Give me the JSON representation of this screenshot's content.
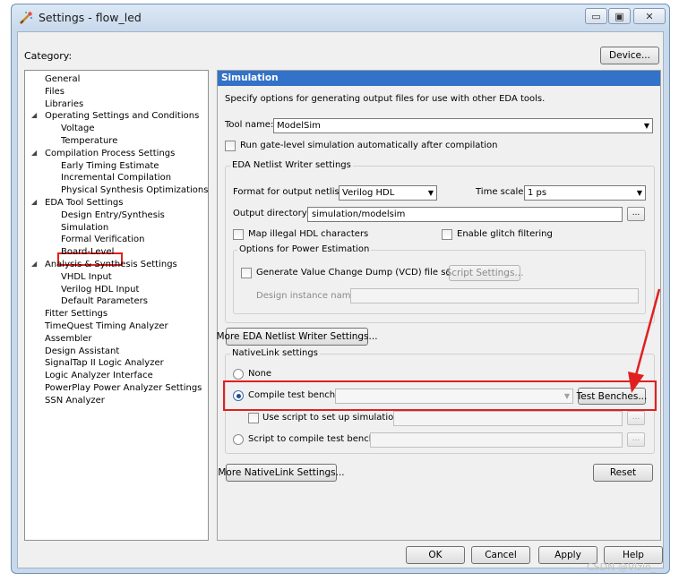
{
  "window": {
    "title": "Settings - flow_led",
    "minimize_glyph": "▭",
    "maximize_glyph": "▣",
    "close_glyph": "✕"
  },
  "category": {
    "label": "Category:"
  },
  "device_button": "Device...",
  "tree": [
    {
      "label": "General",
      "level": 0
    },
    {
      "label": "Files",
      "level": 0
    },
    {
      "label": "Libraries",
      "level": 0
    },
    {
      "label": "Operating Settings and Conditions",
      "level": 0,
      "expanded": true
    },
    {
      "label": "Voltage",
      "level": 1
    },
    {
      "label": "Temperature",
      "level": 1
    },
    {
      "label": "Compilation Process Settings",
      "level": 0,
      "expanded": true
    },
    {
      "label": "Early Timing Estimate",
      "level": 1
    },
    {
      "label": "Incremental Compilation",
      "level": 1
    },
    {
      "label": "Physical Synthesis Optimizations",
      "level": 1
    },
    {
      "label": "EDA Tool Settings",
      "level": 0,
      "expanded": true
    },
    {
      "label": "Design Entry/Synthesis",
      "level": 1
    },
    {
      "label": "Simulation",
      "level": 1,
      "selected": true
    },
    {
      "label": "Formal Verification",
      "level": 1
    },
    {
      "label": "Board-Level",
      "level": 1
    },
    {
      "label": "Analysis & Synthesis Settings",
      "level": 0,
      "expanded": true
    },
    {
      "label": "VHDL Input",
      "level": 1
    },
    {
      "label": "Verilog HDL Input",
      "level": 1
    },
    {
      "label": "Default Parameters",
      "level": 1
    },
    {
      "label": "Fitter Settings",
      "level": 0
    },
    {
      "label": "TimeQuest Timing Analyzer",
      "level": 0
    },
    {
      "label": "Assembler",
      "level": 0
    },
    {
      "label": "Design Assistant",
      "level": 0
    },
    {
      "label": "SignalTap II Logic Analyzer",
      "level": 0
    },
    {
      "label": "Logic Analyzer Interface",
      "level": 0
    },
    {
      "label": "PowerPlay Power Analyzer Settings",
      "level": 0
    },
    {
      "label": "SSN Analyzer",
      "level": 0
    }
  ],
  "panel": {
    "header": "Simulation",
    "description": "Specify options for generating output files for use with other EDA tools.",
    "tool_name_label": "Tool name:",
    "tool_name_value": "ModelSim",
    "run_gate_level_label": "Run gate-level simulation automatically after compilation",
    "netlist_group": {
      "title": "EDA Netlist Writer settings",
      "format_label": "Format for output netlist:",
      "format_value": "Verilog HDL",
      "time_scale_label": "Time scale:",
      "time_scale_value": "1 ps",
      "output_dir_label": "Output directory:",
      "output_dir_value": "simulation/modelsim",
      "browse": "...",
      "map_illegal_label": "Map illegal HDL characters",
      "glitch_label": "Enable glitch filtering",
      "power_group": {
        "title": "Options for Power Estimation",
        "vcd_label": "Generate Value Change Dump (VCD) file script",
        "script_settings": "Script Settings...",
        "instance_label": "Design instance name:"
      }
    },
    "more_eda_button": "More EDA Netlist Writer Settings...",
    "nativelink_group": {
      "title": "NativeLink settings",
      "none_label": "None",
      "compile_label": "Compile test bench:",
      "test_benches_button": "Test Benches...",
      "use_script_label": "Use script to set up simulation:",
      "script_compile_label": "Script to compile test bench:",
      "browse": "..."
    },
    "more_nativelink_button": "More NativeLink Settings...",
    "reset_button": "Reset"
  },
  "footer": {
    "ok": "OK",
    "cancel": "Cancel",
    "apply": "Apply",
    "help": "Help"
  },
  "watermark": "CSDN @Vizio_",
  "colors": {
    "header_blue": "#3272c8",
    "annotation_red": "#e02020"
  }
}
